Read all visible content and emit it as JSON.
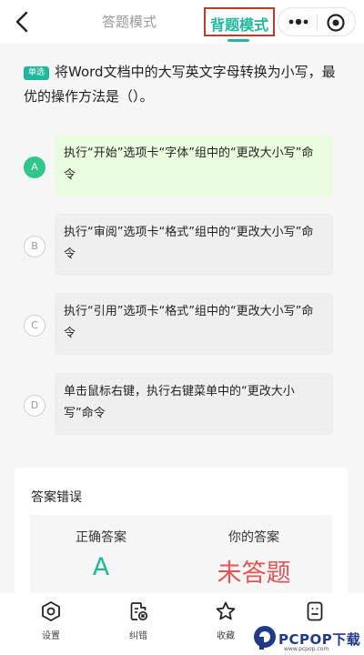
{
  "header": {
    "tab_answer_mode": "答题模式",
    "tab_recite_mode": "背题模式",
    "active_tab": "背题模式",
    "accent_color": "#1fb89a",
    "highlight_border_color": "#c0392b"
  },
  "question": {
    "type_badge": "单选",
    "text": "将Word文档中的大写英文字母转换为小写，最优的操作方法是（）。"
  },
  "options": [
    {
      "letter": "A",
      "text": "执行“开始”选项卡“字体”组中的“更改大小写”命令",
      "is_correct": true
    },
    {
      "letter": "B",
      "text": "执行“审阅”选项卡“格式”组中的“更改大小写”命令",
      "is_correct": false
    },
    {
      "letter": "C",
      "text": "执行“引用”选项卡“格式”组中的“更改大小写”命令",
      "is_correct": false
    },
    {
      "letter": "D",
      "text": "单击鼠标右键，执行右键菜单中的“更改大小写”命令",
      "is_correct": false
    }
  ],
  "answer_card": {
    "title": "答案错误",
    "correct_label": "正确答案",
    "correct_value": "A",
    "your_label": "你的答案",
    "your_value": "未答题"
  },
  "bottom_nav": [
    {
      "label": "设置",
      "icon": "hexagon-settings-icon"
    },
    {
      "label": "纠错",
      "icon": "report-error-icon"
    },
    {
      "label": "收藏",
      "icon": "star-icon"
    },
    {
      "label": "",
      "icon": "answer-sheet-icon"
    }
  ],
  "watermark": {
    "brand": "PCPOP下载",
    "url": "www.pcpop.com"
  }
}
